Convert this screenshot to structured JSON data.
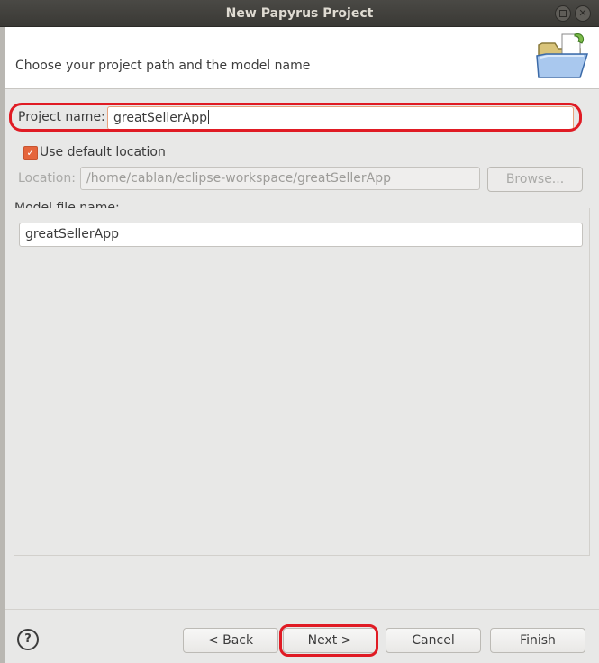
{
  "window": {
    "title": "New Papyrus Project"
  },
  "header": {
    "message": "Choose your project path and the model name",
    "icon": "folder-open-icon"
  },
  "project": {
    "name_label": "Project name:",
    "name_value": "greatSellerApp"
  },
  "location": {
    "use_default_label": "Use default location",
    "use_default_checked": true,
    "label": "Location:",
    "value": "/home/cablan/eclipse-workspace/greatSellerApp",
    "browse_label": "Browse..."
  },
  "model": {
    "group_label": "Model file name:",
    "value": "greatSellerApp"
  },
  "buttons": {
    "back": "< Back",
    "next": "Next >",
    "cancel": "Cancel",
    "finish": "Finish",
    "help": "?"
  },
  "colors": {
    "highlight": "#e01b24",
    "checkbox": "#e5653c",
    "titlebar": "#3c3b37"
  }
}
